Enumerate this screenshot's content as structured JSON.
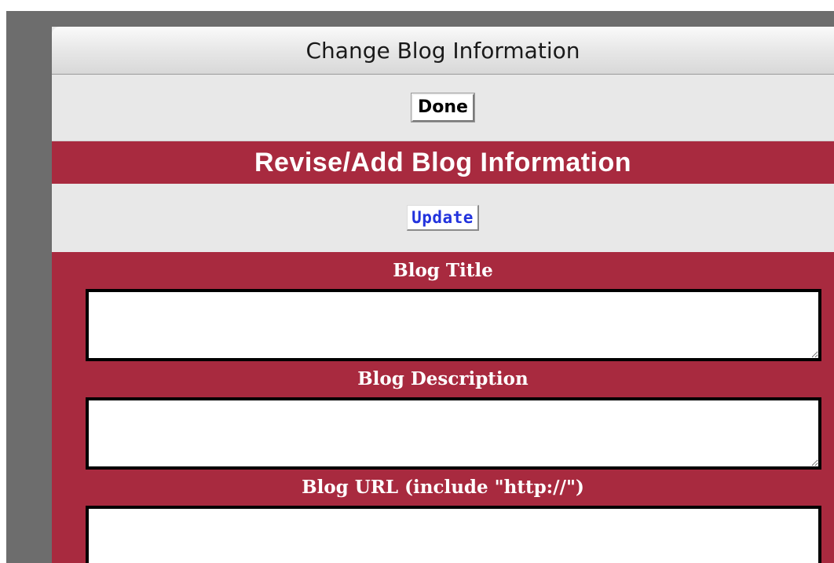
{
  "window": {
    "title": "Change Blog Information"
  },
  "toolbar": {
    "done_label": "Done"
  },
  "section": {
    "header": "Revise/Add Blog Information"
  },
  "actions": {
    "update_label": "Update"
  },
  "fields": {
    "title": {
      "label": "Blog Title",
      "value": ""
    },
    "description": {
      "label": "Blog Description",
      "value": ""
    },
    "url": {
      "label": "Blog URL (include \"http://\")",
      "value": ""
    }
  },
  "colors": {
    "accent": "#a82a3f",
    "panel_bg": "#e8e8e8",
    "outer_bg": "#6d6d6d",
    "link_blue": "#2233dd"
  }
}
